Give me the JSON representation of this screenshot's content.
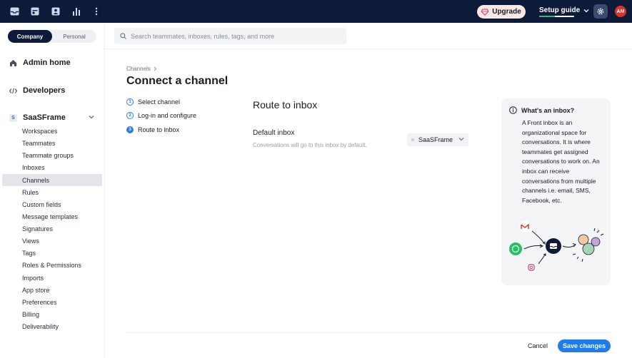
{
  "topbar": {
    "icons": [
      "inbox-icon",
      "calendar-icon",
      "contacts-icon",
      "analytics-icon",
      "more-icon"
    ],
    "upgrade_label": "Upgrade",
    "setup_label": "Setup guide",
    "setup_progress": 0.45,
    "avatar_initials": "AM"
  },
  "sidebar": {
    "toggle": {
      "left": "Company",
      "right": "Personal",
      "selected": "Company"
    },
    "admin_home": "Admin home",
    "developers": "Developers",
    "workspace": {
      "badge": "S",
      "name": "SaaSFrame"
    },
    "items": [
      "Workspaces",
      "Teammates",
      "Teammate groups",
      "Inboxes",
      "Channels",
      "Rules",
      "Custom fields",
      "Message templates",
      "Signatures",
      "Views",
      "Tags",
      "Roles & Permissions",
      "Imports",
      "App store",
      "Preferences",
      "Billing",
      "Deliverability"
    ],
    "active_item": "Channels"
  },
  "search": {
    "placeholder": "Search teammates, inboxes, rules, tags, and more"
  },
  "main": {
    "breadcrumb": "Channels",
    "title": "Connect a channel",
    "steps": [
      {
        "num": "1",
        "label": "Select channel"
      },
      {
        "num": "2",
        "label": "Log-in and configure"
      },
      {
        "num": "3",
        "label": "Route to inbox"
      }
    ],
    "route_title": "Route to inbox",
    "default_inbox_label": "Default inbox",
    "default_inbox_help": "Conversations will go to this inbox by default.",
    "selected_inbox": "SaaSFrame"
  },
  "info_card": {
    "title": "What's an inbox?",
    "body": "A Front inbox is an organizational space for conversations. It is where teammates get assigned conversations to work on. An inbox can receive conversations from multiple channels i.e. email, SMS, Facebook, etc."
  },
  "footer": {
    "cancel_label": "Cancel",
    "save_label": "Save changes"
  },
  "colors": {
    "topbar": "#0e1a3a",
    "accent": "#1f7cf0",
    "avatar": "#d9342b"
  }
}
